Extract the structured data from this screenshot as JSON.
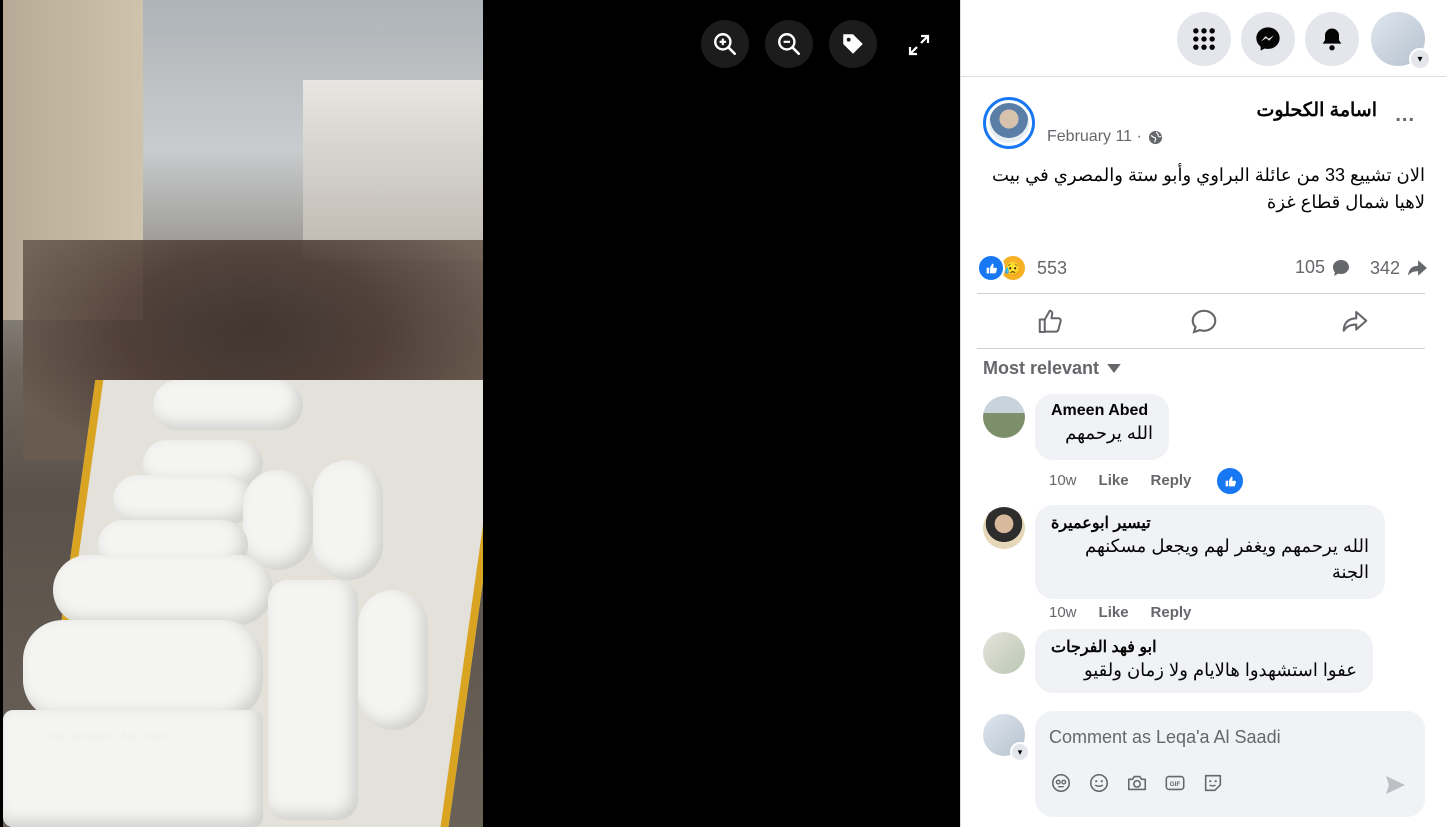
{
  "viewer": {
    "photo_credit": "Abd elhkeem Abo riash",
    "buttons": [
      "zoom-in-icon",
      "zoom-out-icon",
      "tag-icon",
      "fullscreen-icon"
    ]
  },
  "topbar": {
    "icons": [
      "menu-grid-icon",
      "messenger-icon",
      "bell-icon",
      "profile-avatar"
    ]
  },
  "post": {
    "author": "اسامة الكحلوت",
    "more": "...",
    "date": "February 11 ·",
    "text": "الان تشييع 33 من عائلة البراوي وأبو ستة والمصري في بيت لاهيا شمال قطاع غزة",
    "reaction_count": "553",
    "comment_count": "105",
    "share_count": "342"
  },
  "comments_section": {
    "sort_label": "Most relevant",
    "comments": [
      {
        "name": "Ameen Abed",
        "text": "الله يرحمهم",
        "time": "10w",
        "like": "Like",
        "reply": "Reply"
      },
      {
        "name": "تيسير ابوعميرة",
        "text": "الله يرحمهم ويغفر لهم ويجعل مسكنهم الجنة",
        "time": "10w",
        "like": "Like",
        "reply": "Reply"
      },
      {
        "name": "ابو فهد الفرجات",
        "text": "عفوا استشهدوا هالايام ولا زمان ولقيو"
      }
    ]
  },
  "composer": {
    "placeholder": "Comment as Leqa'a Al Saadi"
  },
  "colors": {
    "accent": "#1877f2",
    "muted": "#65676b",
    "bubble": "#f0f2f5"
  }
}
